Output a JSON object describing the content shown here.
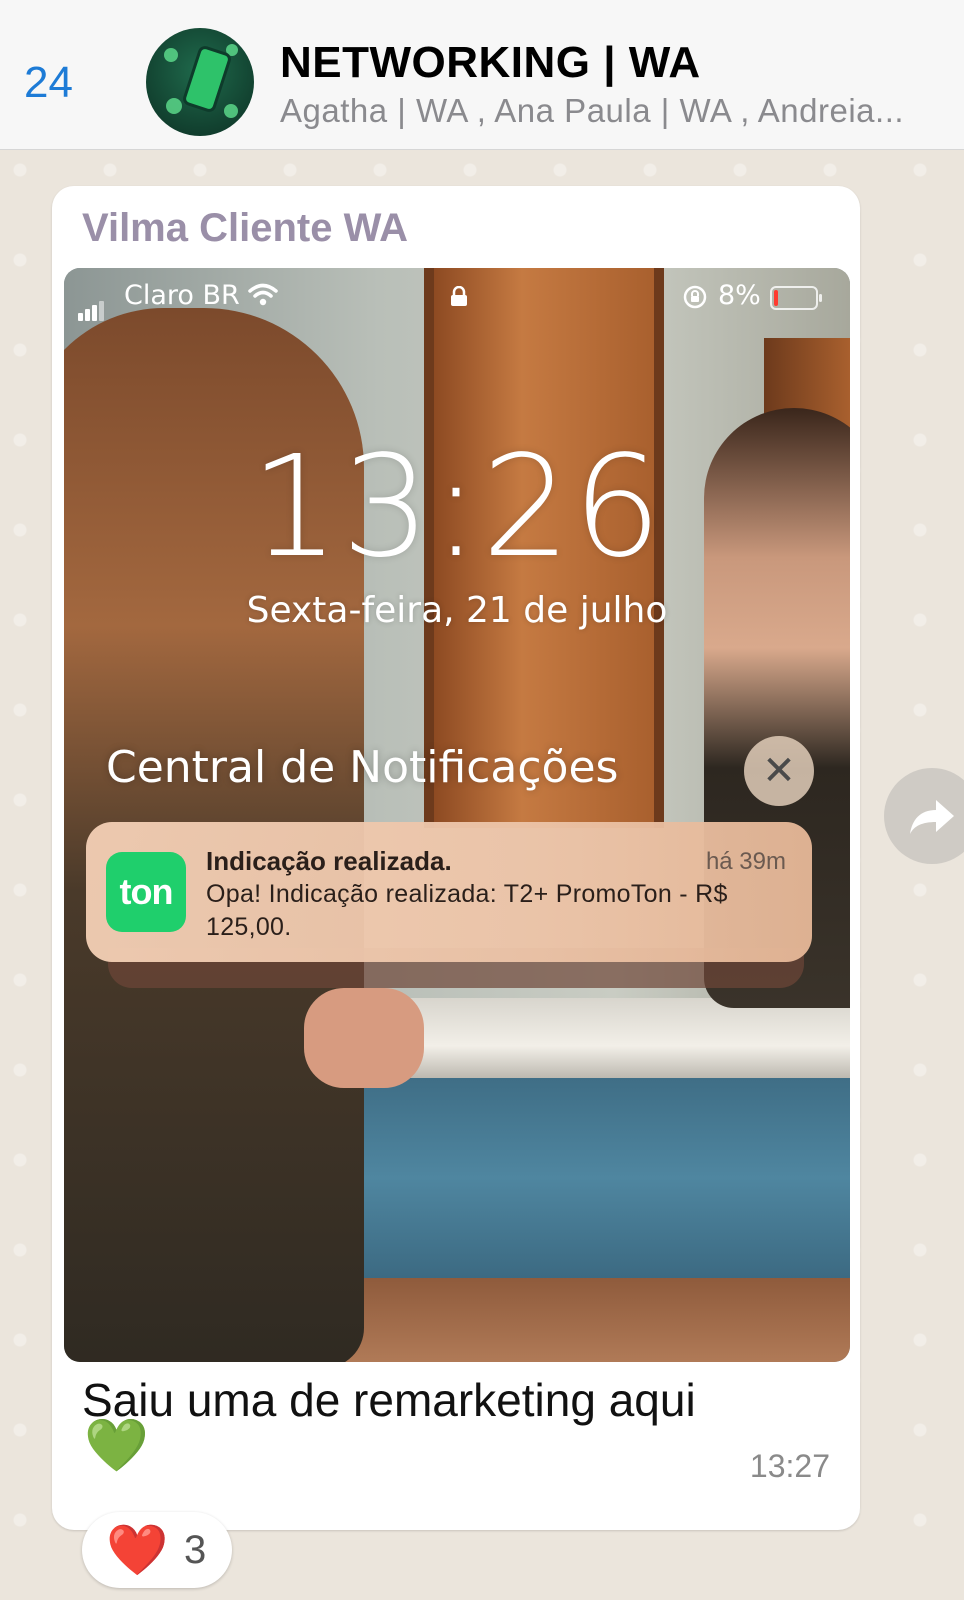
{
  "header": {
    "back_count": "24",
    "group_title": "NETWORKING | WA",
    "members": "Agatha | WA , Ana Paula | WA , Andreia..."
  },
  "message": {
    "sender": "Vilma Cliente WA",
    "caption": "Saiu uma de remarketing aqui",
    "emoji": "💚",
    "time": "13:27",
    "reaction": {
      "emoji": "❤️",
      "count": "3"
    }
  },
  "screenshot": {
    "carrier": "Claro BR",
    "battery": "8%",
    "lock_time": "13:26",
    "lock_date": "Sexta-feira, 21 de julho",
    "notification_center_title": "Central de Notificações",
    "close_symbol": "✕",
    "notification": {
      "app_icon_label": "ton",
      "title": "Indicação realizada.",
      "time": "há 39m",
      "body": "Opa! Indicação realizada: T2+ PromoTon - R$ 125,00."
    }
  },
  "colors": {
    "accent_blue": "#1d7bd6",
    "ton_green": "#1fcf6c",
    "sender_color": "#9a8fa8",
    "bubble_bg": "#ffffff"
  }
}
